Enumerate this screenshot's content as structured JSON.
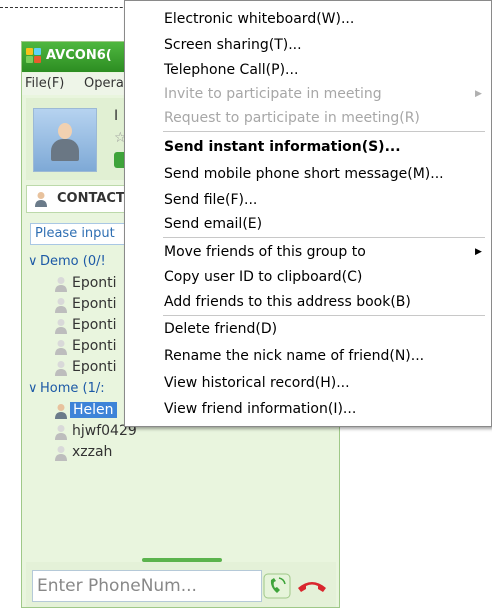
{
  "app": {
    "title": "AVCON6(",
    "menu_file": "File(F)",
    "menu_operation": "Opera",
    "profile_initial": "I",
    "star_glyph": "☆",
    "contacts_tab": "CONTACT",
    "search_placeholder": "Please input",
    "groups": [
      {
        "label": "Demo (0/!",
        "expanded": true,
        "friends": [
          "Eponti",
          "Eponti",
          "Eponti",
          "Eponti",
          "Eponti"
        ]
      },
      {
        "label": "Home (1/:",
        "expanded": true,
        "friends": [
          "Helen",
          "hjwf0429",
          "xzzah"
        ]
      }
    ],
    "selected_friend": "Helen",
    "phone_placeholder": "Enter PhoneNum..."
  },
  "menu": {
    "items": [
      {
        "label": "Electronic whiteboard(W)...",
        "enabled": true
      },
      {
        "label": "Screen sharing(T)...",
        "enabled": true
      },
      {
        "label": "Telephone Call(P)...",
        "enabled": true
      },
      {
        "label": "Invite to participate in meeting",
        "enabled": false,
        "submenu": true
      },
      {
        "label": "Request to participate in meeting(R)",
        "enabled": false
      },
      {
        "label": "Send instant information(S)...",
        "enabled": true,
        "bold": true
      },
      {
        "label": "Send mobile phone short message(M)...",
        "enabled": true
      },
      {
        "label": "Send file(F)...",
        "enabled": true
      },
      {
        "label": "Send email(E)",
        "enabled": true
      },
      {
        "label": "Move friends of this group to",
        "enabled": true,
        "submenu": true
      },
      {
        "label": "Copy user ID to clipboard(C)",
        "enabled": true
      },
      {
        "label": "Add friends to this address book(B)",
        "enabled": true
      },
      {
        "label": "Delete friend(D)",
        "enabled": true
      },
      {
        "label": "Rename the nick name of friend(N)...",
        "enabled": true
      },
      {
        "label": "View historical record(H)...",
        "enabled": true
      },
      {
        "label": "View friend information(I)...",
        "enabled": true
      }
    ],
    "submenu_arrow": "▶"
  },
  "icons": {
    "app_logo": "avcon-logo-icon",
    "contacts": "contacts-person-icon",
    "friend": "friend-person-icon",
    "call": "phone-call-icon",
    "hangup": "hang-up-icon"
  },
  "colors": {
    "title_green": "#2c8d22",
    "selection_blue": "#3d83d8",
    "group_blue": "#1c59a6",
    "disabled_gray": "#a7a7a7",
    "hangup_red": "#d9272e",
    "call_green": "#3ea43a"
  }
}
